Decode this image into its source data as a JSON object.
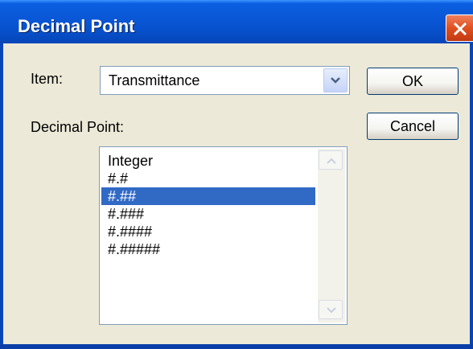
{
  "window": {
    "title": "Decimal Point"
  },
  "item": {
    "label": "Item:",
    "selected_value": "Transmittance"
  },
  "buttons": {
    "ok_label": "OK",
    "cancel_label": "Cancel"
  },
  "decimal_point": {
    "label": "Decimal Point:",
    "options": [
      "Integer",
      "#.#",
      "#.##",
      "#.###",
      "#.####",
      "#.#####"
    ],
    "selected_index": 2
  },
  "colors": {
    "titlebar": "#0A58D8",
    "selection": "#316AC5",
    "dialog_bg": "#ECE9D8",
    "close_button": "#E0501F"
  },
  "icons": {
    "close": "close-icon",
    "dropdown": "chevron-down-icon",
    "scroll_up": "scroll-up-arrow-icon",
    "scroll_down": "scroll-down-arrow-icon"
  }
}
